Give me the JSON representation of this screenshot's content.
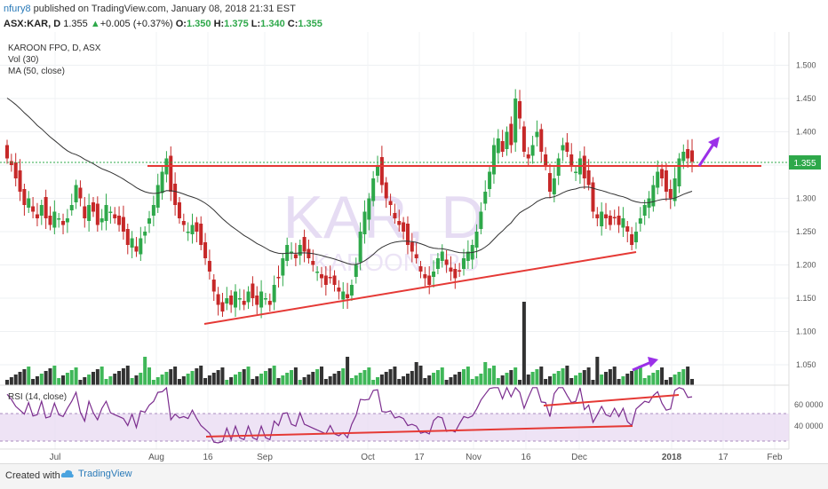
{
  "header": {
    "user": "nfury8",
    "published": "published on TradingView.com, January 08, 2018 21:31 EST",
    "symbol": "ASX:KAR, D",
    "price": "1.355",
    "arrow": "▲",
    "change": "+0.005 (+0.37%)",
    "o_label": "O:",
    "o_value": "1.350",
    "h_label": "H:",
    "h_value": "1.375",
    "l_label": "L:",
    "l_value": "1.340",
    "c_label": "C:",
    "c_value": "1.355"
  },
  "legend": {
    "line1": "KAROON FPO, D, ASX",
    "line2": "Vol (30)",
    "line3": "MA (50, close)",
    "rsi": "RSI (14, close)"
  },
  "watermark": {
    "big": "KAR, D",
    "small": "KAROON FPO"
  },
  "last_price_tag": "1.355",
  "footer": {
    "created": "Created with",
    "brand": "TradingView"
  },
  "colors": {
    "up": "#2ea84a",
    "down": "#c62828",
    "line_red": "#e53935",
    "arrow": "#9b30e8",
    "rsi": "#7b2d8e",
    "ma": "#333333"
  },
  "chart_data": {
    "type": "candlestick",
    "title": "KAROON FPO, D, ASX",
    "y_ticks": [
      "1.500",
      "1.450",
      "1.400",
      "1.350",
      "1.300",
      "1.250",
      "1.200",
      "1.150",
      "1.100",
      "1.050"
    ],
    "ylim": [
      1.02,
      1.54
    ],
    "x_ticks": [
      "Jul",
      "Aug",
      "16",
      "Sep",
      "Oct",
      "17",
      "Nov",
      "16",
      "Dec",
      "2018",
      "17",
      "Feb"
    ],
    "rsi_ticks": [
      "60 0000",
      "40 0000"
    ],
    "close": [
      1.36,
      1.35,
      1.33,
      1.31,
      1.29,
      1.3,
      1.28,
      1.27,
      1.29,
      1.27,
      1.26,
      1.28,
      1.27,
      1.26,
      1.27,
      1.29,
      1.32,
      1.3,
      1.27,
      1.29,
      1.28,
      1.26,
      1.27,
      1.29,
      1.28,
      1.27,
      1.26,
      1.25,
      1.23,
      1.24,
      1.22,
      1.24,
      1.25,
      1.27,
      1.29,
      1.32,
      1.34,
      1.36,
      1.31,
      1.29,
      1.27,
      1.26,
      1.25,
      1.26,
      1.25,
      1.23,
      1.21,
      1.19,
      1.16,
      1.14,
      1.13,
      1.15,
      1.14,
      1.16,
      1.15,
      1.14,
      1.16,
      1.15,
      1.14,
      1.16,
      1.15,
      1.14,
      1.17,
      1.18,
      1.21,
      1.23,
      1.22,
      1.21,
      1.23,
      1.22,
      1.21,
      1.2,
      1.19,
      1.18,
      1.17,
      1.18,
      1.17,
      1.16,
      1.16,
      1.15,
      1.17,
      1.2,
      1.25,
      1.28,
      1.3,
      1.33,
      1.35,
      1.32,
      1.3,
      1.29,
      1.27,
      1.26,
      1.25,
      1.23,
      1.22,
      1.21,
      1.19,
      1.18,
      1.17,
      1.19,
      1.21,
      1.22,
      1.2,
      1.19,
      1.18,
      1.19,
      1.21,
      1.22,
      1.23,
      1.25,
      1.28,
      1.31,
      1.34,
      1.38,
      1.39,
      1.37,
      1.4,
      1.38,
      1.45,
      1.42,
      1.37,
      1.36,
      1.38,
      1.4,
      1.37,
      1.35,
      1.31,
      1.33,
      1.36,
      1.38,
      1.37,
      1.35,
      1.34,
      1.36,
      1.33,
      1.32,
      1.28,
      1.27,
      1.28,
      1.27,
      1.26,
      1.27,
      1.26,
      1.27,
      1.25,
      1.23,
      1.25,
      1.27,
      1.29,
      1.3,
      1.32,
      1.34,
      1.33,
      1.31,
      1.3,
      1.33,
      1.36,
      1.37,
      1.36,
      1.355
    ],
    "rsi_range": [
      20,
      80
    ]
  }
}
